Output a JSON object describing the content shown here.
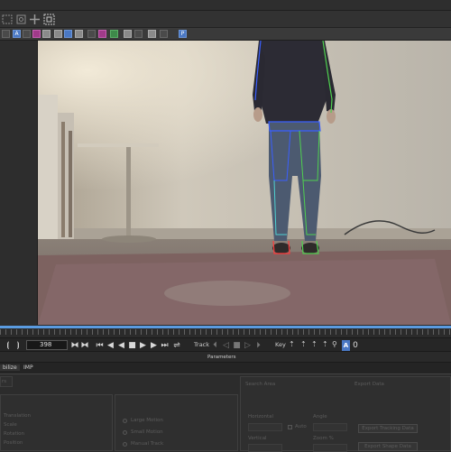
{
  "toolbar": {
    "tools": [
      "lasso-tool",
      "transform-tool",
      "move-tool",
      "select-region-tool"
    ]
  },
  "icon_bar": {
    "items": [
      "A",
      "blue-tool",
      "gear",
      "layers",
      "layer-view",
      "grid",
      "mask",
      "overlay",
      "contrast",
      "pin",
      "star",
      "sun",
      "P"
    ],
    "letter_a": "A",
    "letter_p": "P"
  },
  "viewer": {
    "overlay_colors": {
      "blue": "#3a5fff",
      "green": "#4fd04f",
      "red": "#ff3b3b",
      "cyan": "#4fd0d0"
    }
  },
  "transport": {
    "frame": "398",
    "track_label": "Track",
    "key_label": "Key",
    "letter_a": "A"
  },
  "parameters": {
    "header": "Parameters"
  },
  "tabs": {
    "stabilize": "bilize",
    "imp": "IMP"
  },
  "panel": {
    "left_tab": "rs",
    "labels": [
      "Translation",
      "Scale",
      "Rotation",
      "Position"
    ],
    "motion_options": [
      "Large Motion",
      "Small Motion",
      "Manual Track"
    ],
    "search_area": "Search Area",
    "export_data": "Export Data",
    "horizontal": "Horizontal",
    "auto": "Auto",
    "vertical": "Vertical",
    "angle": "Angle",
    "zoom": "Zoom %",
    "export_button_1": "Export Tracking Data",
    "export_button_2": "Export Shape Data"
  }
}
